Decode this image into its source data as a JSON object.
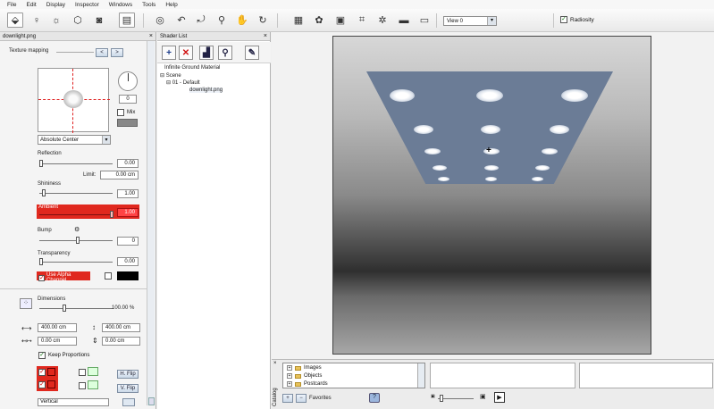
{
  "menu": [
    "File",
    "Edit",
    "Display",
    "Inspector",
    "Windows",
    "Tools",
    "Help"
  ],
  "toolbar": {
    "view_select": "View 0",
    "radiosity_label": "Radiosity",
    "radiosity_checked": true
  },
  "inspector": {
    "tab_title": "downlight.png",
    "section": "Texture mapping",
    "nav_prev": "<",
    "nav_next": ">",
    "angle_value": "0",
    "mix_label": "Mix",
    "mapping_mode": "Absolute Center",
    "reflection_label": "Reflection",
    "reflection_value": "0.00",
    "limit_label": "Limit:",
    "limit_value": "0.00 cm",
    "shininess_label": "Shininess",
    "shininess_value": "1.00",
    "ambient_label": "Ambient",
    "ambient_value": "1.00",
    "bump_label": "Bump",
    "bump_value": "0",
    "transparency_label": "Transparency",
    "transparency_value": "0.00",
    "alpha_label": "Use Alpha Channel",
    "dimensions_label": "Dimensions",
    "dimensions_percent": "100.00 %",
    "width_value": "400.00 cm",
    "height_value": "400.00 cm",
    "offset_x": "0.00 cm",
    "offset_y": "0.00 cm",
    "keep_proportions_label": "Keep Proportions",
    "hflip_label": "H. Flip",
    "vflip_label": "V. Flip",
    "bottom_select": "Vertical"
  },
  "shader_list": {
    "title": "Shader List",
    "tree": [
      {
        "label": "Infinite Ground Material",
        "indent": 0
      },
      {
        "label": "Scene",
        "indent": 0
      },
      {
        "label": "01 - Default",
        "indent": 1
      },
      {
        "label": "downlight.png",
        "indent": 2
      }
    ]
  },
  "catalog": {
    "label": "Catalog",
    "items": [
      "Images",
      "Objects",
      "Postcards"
    ],
    "favorites_label": "Favorites"
  },
  "colors": {
    "accent_red": "#e0281e",
    "ceiling": "#6b7c96"
  }
}
